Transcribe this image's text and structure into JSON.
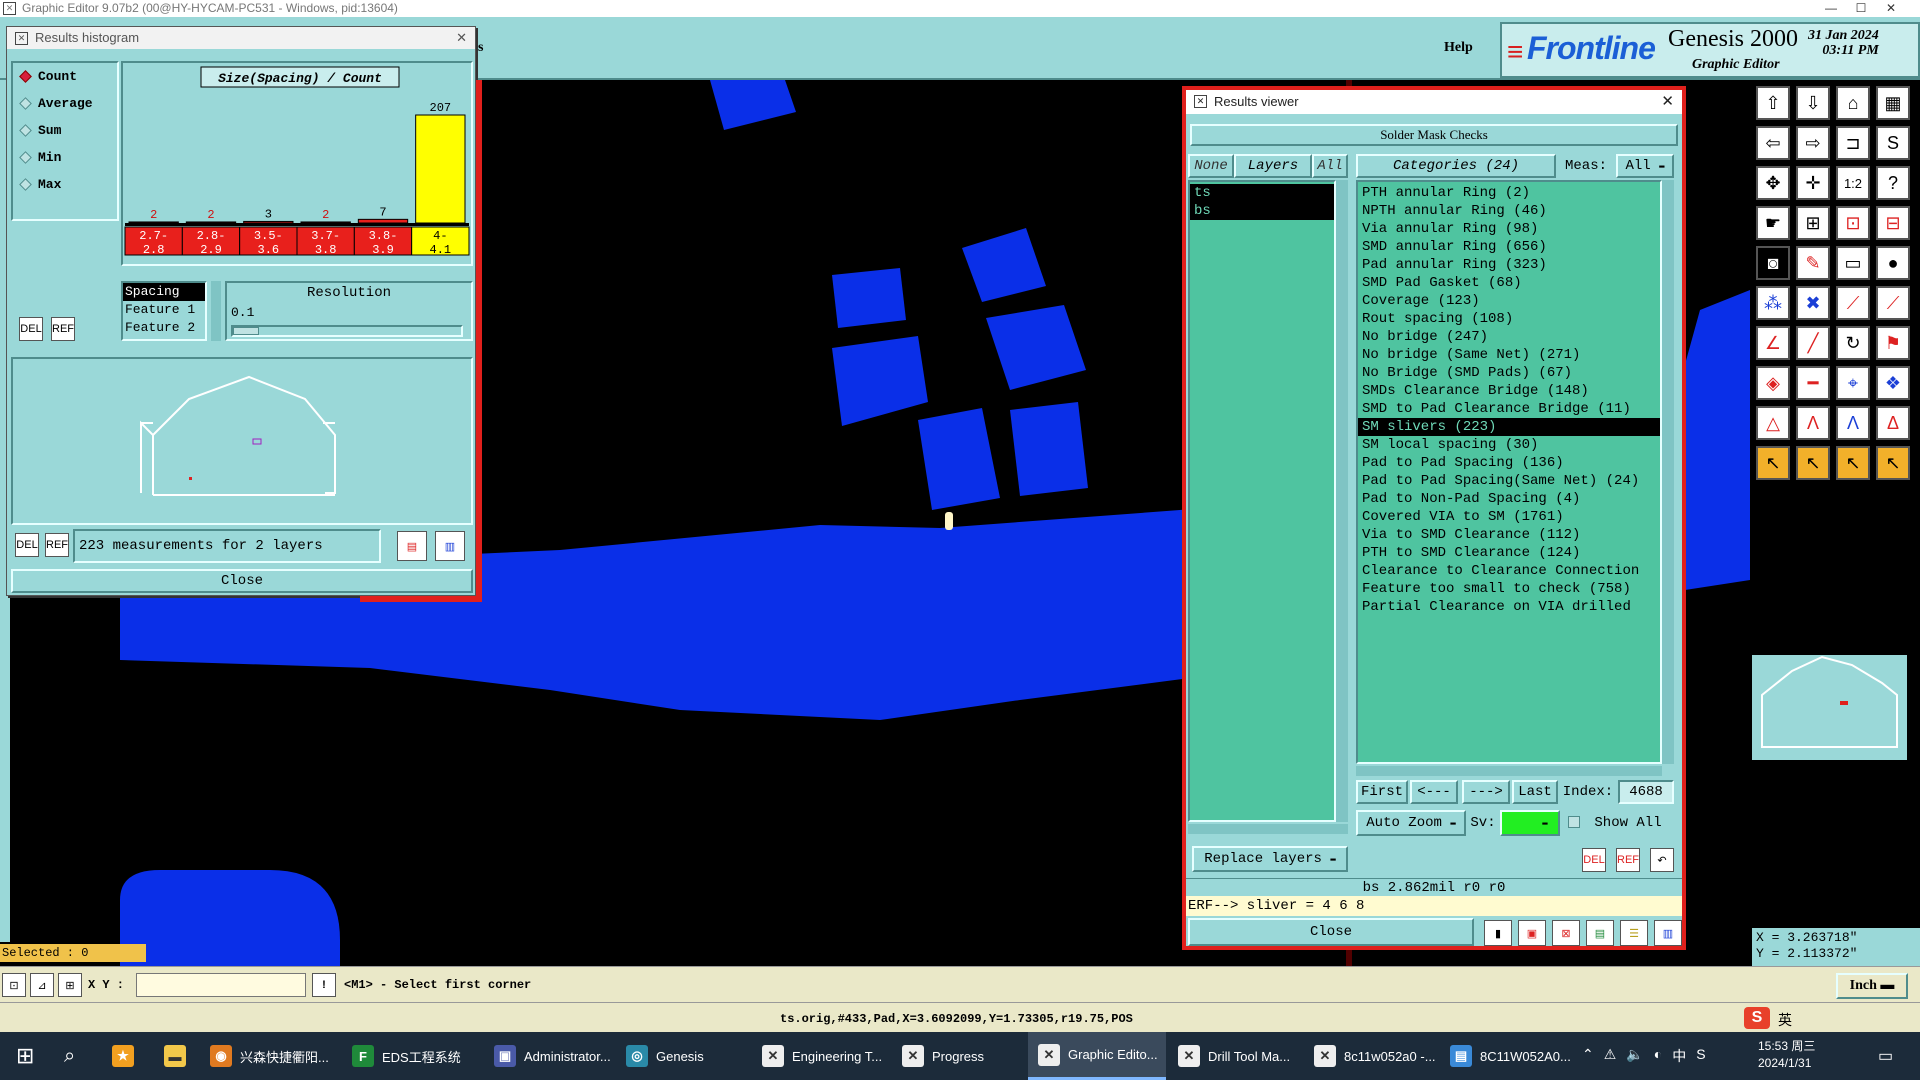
{
  "window": {
    "title": "Graphic Editor 9.07b2 (00@HY-HYCAM-PC531 - Windows, pid:13604)"
  },
  "header": {
    "help_label": "Help",
    "brand": "Frontline",
    "product": "Genesis 2000",
    "subtitle": "Graphic Editor",
    "date": "31 Jan 2024",
    "time": "03:11 PM",
    "partial_label": "s"
  },
  "histogram": {
    "title": "Results histogram",
    "modes": [
      {
        "label": "Count",
        "selected": true
      },
      {
        "label": "Average",
        "selected": false
      },
      {
        "label": "Sum",
        "selected": false
      },
      {
        "label": "Min",
        "selected": false
      },
      {
        "label": "Max",
        "selected": false
      }
    ],
    "chart_title": "Size(Spacing) / Count",
    "summary": "223 measurements for 2 layers",
    "spacing_list": [
      "Spacing",
      "Feature 1",
      "Feature 2"
    ],
    "resolution_label": "Resolution",
    "resolution_value": "0.1",
    "close_label": "Close",
    "del_label": "DEL",
    "ref_label": "REF"
  },
  "chart_data": {
    "type": "bar",
    "title": "Size(Spacing) / Count",
    "categories": [
      "2.7-2.8",
      "2.8-2.9",
      "3.5-3.6",
      "3.7-3.8",
      "3.8-3.9",
      "4-4.1"
    ],
    "values": [
      2,
      2,
      3,
      2,
      7,
      207
    ],
    "colors": [
      "#e8201c",
      "#e8201c",
      "#e8201c",
      "#e8201c",
      "#e8201c",
      "#ffff00"
    ],
    "highlight_index": 5
  },
  "results_viewer": {
    "title": "Results viewer",
    "header": "Solder Mask Checks",
    "none_label": "None",
    "layers_label": "Layers",
    "all_label": "All",
    "categories_label": "Categories (24)",
    "meas_label": "Meas:",
    "meas_value": "All",
    "layers": [
      "ts",
      "bs"
    ],
    "categories": [
      "PTH annular Ring (2)",
      "NPTH annular Ring (46)",
      "Via annular Ring (98)",
      "SMD annular Ring (656)",
      "Pad annular Ring (323)",
      "SMD Pad Gasket (68)",
      "Coverage (123)",
      "Rout spacing (108)",
      "No bridge (247)",
      "No bridge (Same Net) (271)",
      "No Bridge (SMD Pads) (67)",
      "SMDs Clearance Bridge (148)",
      "SMD to Pad Clearance Bridge (11)",
      "SM slivers (223)",
      "SM local spacing (30)",
      "Pad to Pad Spacing (136)",
      "Pad to Pad Spacing(Same Net) (24)",
      "Pad to Non-Pad Spacing (4)",
      "Covered VIA to SM (1761)",
      "Via to SMD Clearance (112)",
      "PTH to SMD Clearance (124)",
      "Clearance to Clearance Connection",
      "Feature too small to check (758)",
      "Partial Clearance on VIA drilled"
    ],
    "selected_category": "SM slivers (223)",
    "first_label": "First",
    "prev_label": "<---",
    "next_label": "--->",
    "last_label": "Last",
    "index_label": "Index:",
    "index_value": "4688",
    "auto_zoom_label": "Auto Zoom",
    "sv_label": "Sv:",
    "show_all_label": "Show All",
    "replace_layers_label": "Replace layers",
    "measure_line": "bs 2.862mil  r0  r0",
    "erf_line": "ERF--> sliver = 4 6 8",
    "close_label": "Close"
  },
  "status": {
    "selected": "Selected : 0",
    "xy_label": "X Y :",
    "xy_value": "",
    "prompt": "<M1> - Select first corner",
    "units": "Inch",
    "info": "ts.orig,#433,Pad,X=3.6092099,Y=1.73305,r19.75,POS",
    "x_coord": "X = 3.263718\"",
    "y_coord": "Y = 2.113372\""
  },
  "taskbar": {
    "items": [
      "兴森快捷衢阳...",
      "EDS工程系统",
      "Administrator...",
      "Genesis",
      "Engineering T...",
      "Progress",
      "Graphic Edito...",
      "Drill Tool Ma...",
      "8c11w052a0 -...",
      "8C11W052A0..."
    ],
    "active_index": 6,
    "clock_time": "15:53 周三",
    "clock_date": "2024/1/31",
    "ime": "英",
    "lang": "中"
  }
}
